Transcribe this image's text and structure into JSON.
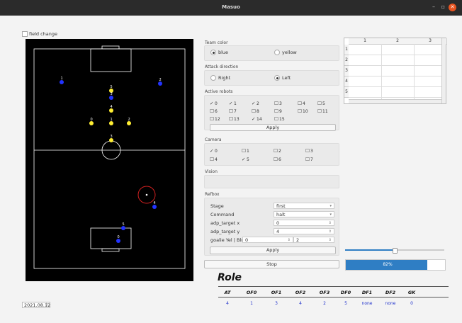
{
  "window": {
    "title": "Masuo",
    "minimize": "–",
    "maximize": "▫",
    "close": "✕"
  },
  "field_change": "field change",
  "robots": [
    {
      "label": "1",
      "team": "blue"
    },
    {
      "label": "2",
      "team": "blue"
    },
    {
      "label": "5",
      "team": "yellow"
    },
    {
      "label": "3",
      "team": "blue"
    },
    {
      "label": "4",
      "team": "yellow"
    },
    {
      "label": "0",
      "team": "yellow"
    },
    {
      "label": "1",
      "team": "yellow"
    },
    {
      "label": "2",
      "team": "yellow"
    },
    {
      "label": "3",
      "team": "yellow"
    },
    {
      "label": "4",
      "team": "blue"
    },
    {
      "label": "5",
      "team": "blue"
    },
    {
      "label": "0",
      "team": "blue"
    }
  ],
  "colors": {
    "blue_robot": "#2233ff",
    "yellow_robot": "#ffee33",
    "ball_circle": "#d02020",
    "accent": "#2f7ec4"
  },
  "team_color": {
    "title": "Team color",
    "options": [
      "blue",
      "yellow"
    ],
    "selected": "blue"
  },
  "attack_direction": {
    "title": "Attack direction",
    "options": [
      "Right",
      "Left"
    ],
    "selected": "Left"
  },
  "active_robots": {
    "title": "Active robots",
    "items": [
      {
        "label": "0",
        "checked": true
      },
      {
        "label": "1",
        "checked": true
      },
      {
        "label": "2",
        "checked": true
      },
      {
        "label": "3",
        "checked": false
      },
      {
        "label": "4",
        "checked": false
      },
      {
        "label": "5",
        "checked": false
      },
      {
        "label": "6",
        "checked": false
      },
      {
        "label": "7",
        "checked": false
      },
      {
        "label": "8",
        "checked": false
      },
      {
        "label": "9",
        "checked": false
      },
      {
        "label": "10",
        "checked": false
      },
      {
        "label": "11",
        "checked": false
      },
      {
        "label": "12",
        "checked": false
      },
      {
        "label": "13",
        "checked": false
      },
      {
        "label": "14",
        "checked": true
      },
      {
        "label": "15",
        "checked": false
      }
    ],
    "apply": "Apply"
  },
  "camera": {
    "title": "Camera",
    "items": [
      {
        "label": "0",
        "checked": true
      },
      {
        "label": "1",
        "checked": false
      },
      {
        "label": "2",
        "checked": false
      },
      {
        "label": "3",
        "checked": false
      },
      {
        "label": "4",
        "checked": false
      },
      {
        "label": "5",
        "checked": true
      },
      {
        "label": "6",
        "checked": false
      },
      {
        "label": "7",
        "checked": false
      }
    ]
  },
  "vision": {
    "title": "Vision"
  },
  "refbox": {
    "title": "Refbox",
    "stage_label": "Stage",
    "stage_value": "first",
    "command_label": "Command",
    "command_value": "halt",
    "adp_x_label": "adp_target x",
    "adp_x_value": "0",
    "adp_y_label": "adp_target y",
    "adp_y_value": "4",
    "goalie_label": "goalie Yel | Blu",
    "goalie_yel": "0",
    "goalie_blu": "2",
    "apply": "Apply"
  },
  "stop": "Stop",
  "table": {
    "columns": [
      "1",
      "2",
      "3"
    ],
    "rows": [
      "1",
      "2",
      "3",
      "4",
      "5"
    ]
  },
  "slider_value": 0.5,
  "progress": {
    "value": 0.82,
    "text": "82%"
  },
  "role": {
    "title": "Role",
    "headers": [
      "AT",
      "OF0",
      "OF1",
      "OF2",
      "OF3",
      "DF0",
      "DF1",
      "DF2",
      "GK"
    ],
    "values": [
      "4",
      "1",
      "3",
      "4",
      "2",
      "5",
      "none",
      "none",
      "0"
    ]
  },
  "date": "2021.08.12"
}
